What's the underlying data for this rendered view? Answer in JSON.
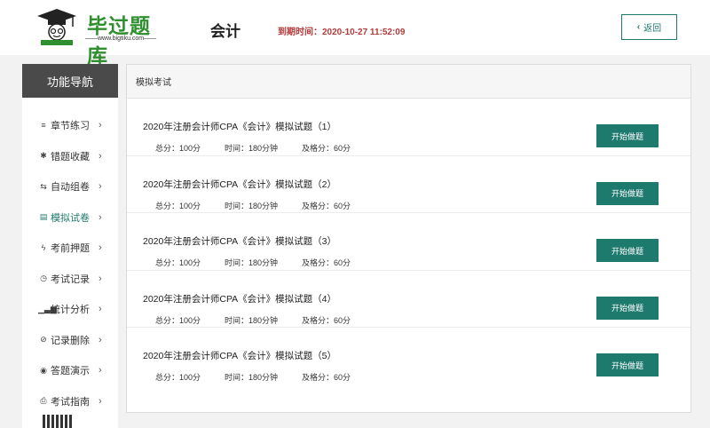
{
  "header": {
    "logo_title": "毕过题库",
    "logo_url": "——www.bigtiku.com——",
    "subject": "会计",
    "expire_label": "到期时间：",
    "expire_value": "2020-10-27 11:52:09",
    "back_label": "返回",
    "back_icon": "chevron-left-icon"
  },
  "sidebar": {
    "title": "功能导航",
    "items": [
      {
        "icon": "≡",
        "icon_name": "list-icon",
        "label": "章节练习",
        "arrow": "›"
      },
      {
        "icon": "✱",
        "icon_name": "asterisk-icon",
        "label": "错题收藏",
        "arrow": "›"
      },
      {
        "icon": "⇆",
        "icon_name": "retweet-icon",
        "label": "自动组卷",
        "arrow": "›"
      },
      {
        "icon": "▤",
        "icon_name": "document-icon",
        "label": "模拟试卷",
        "arrow": "›"
      },
      {
        "icon": "ϟ",
        "icon_name": "bolt-icon",
        "label": "考前押题",
        "arrow": "›"
      },
      {
        "icon": "◷",
        "icon_name": "clock-icon",
        "label": "考试记录",
        "arrow": "›"
      },
      {
        "icon": "▁▃▆",
        "icon_name": "bar-chart-icon",
        "label": "统计分析",
        "arrow": "›"
      },
      {
        "icon": "⊘",
        "icon_name": "ban-icon",
        "label": "记录删除",
        "arrow": "›"
      },
      {
        "icon": "◉",
        "icon_name": "globe-icon",
        "label": "答题演示",
        "arrow": "›"
      },
      {
        "icon": "⎙",
        "icon_name": "print-icon",
        "label": "考试指南",
        "arrow": "›"
      }
    ],
    "active_index": 3
  },
  "panel": {
    "title": "模拟考试",
    "exams": [
      {
        "title": "2020年注册会计师CPA《会计》模拟试题（1）",
        "total": "总分：100分",
        "time": "时间：180分钟",
        "pass": "及格分：60分",
        "button": "开始做题"
      },
      {
        "title": "2020年注册会计师CPA《会计》模拟试题（2）",
        "total": "总分：100分",
        "time": "时间：180分钟",
        "pass": "及格分：60分",
        "button": "开始做题"
      },
      {
        "title": "2020年注册会计师CPA《会计》模拟试题（3）",
        "total": "总分：100分",
        "time": "时间：180分钟",
        "pass": "及格分：60分",
        "button": "开始做题"
      },
      {
        "title": "2020年注册会计师CPA《会计》模拟试题（4）",
        "total": "总分：100分",
        "time": "时间：180分钟",
        "pass": "及格分：60分",
        "button": "开始做题"
      },
      {
        "title": "2020年注册会计师CPA《会计》模拟试题（5）",
        "total": "总分：100分",
        "time": "时间：180分钟",
        "pass": "及格分：60分",
        "button": "开始做题"
      }
    ]
  },
  "colors": {
    "accent": "#1f7a6e",
    "expire": "#b33a3a",
    "logo_green": "#2f8f2f",
    "sidebar_head": "#4a4a4a"
  }
}
